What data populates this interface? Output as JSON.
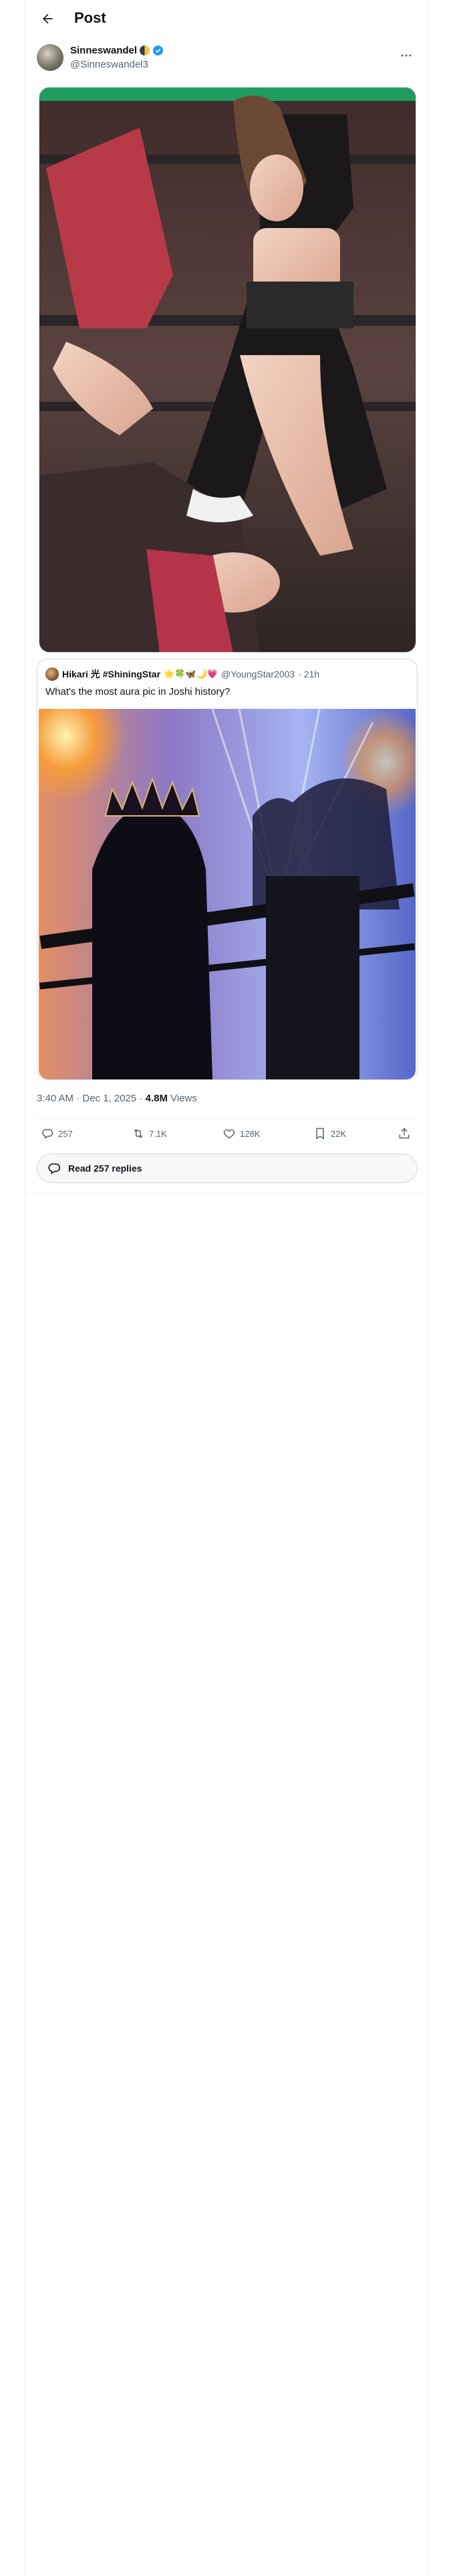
{
  "header": {
    "title": "Post"
  },
  "post": {
    "author_name": "Sinneswandel",
    "author_handle": "@Sinneswandel3",
    "timestamp": "3:40 AM · Dec 1, 2025",
    "views_count": "4.8M",
    "views_label": "Views"
  },
  "quote": {
    "name": "Hikari 光 #ShiningStar",
    "emojis": "🌟🍀🦋🌙💗",
    "handle": "@YoungStar2003",
    "time": "· 21h",
    "text": "What's the most aura pic in Joshi history?"
  },
  "actions": {
    "replies": "257",
    "reposts": "7.1K",
    "likes": "128K",
    "bookmarks": "22K"
  },
  "read_replies": "Read 257 replies",
  "colors": {
    "accent": "#1d9bf0",
    "text": "#0f1419",
    "muted": "#536471",
    "border": "#cfd9de"
  }
}
